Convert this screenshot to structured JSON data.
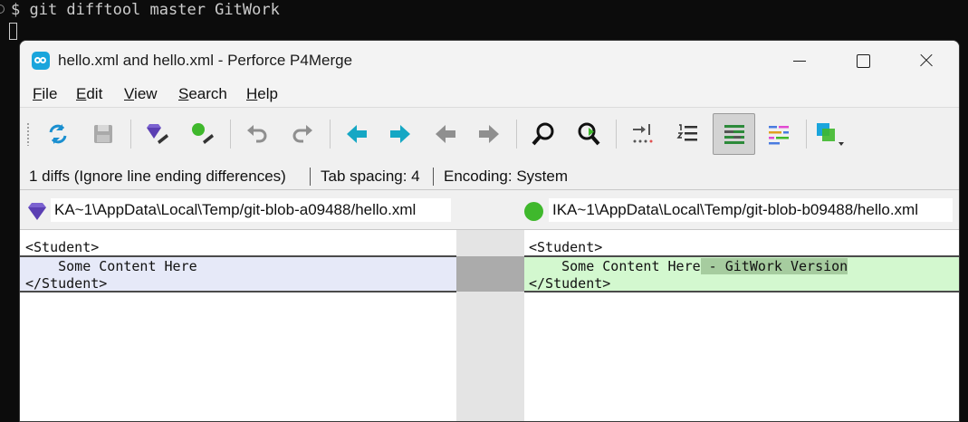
{
  "terminal": {
    "command": "$ git difftool master GitWork"
  },
  "window": {
    "title": "hello.xml and hello.xml - Perforce P4Merge"
  },
  "menu": {
    "items": [
      "File",
      "Edit",
      "View",
      "Search",
      "Help"
    ],
    "underline": [
      "F",
      "E",
      "V",
      "S",
      "H"
    ]
  },
  "toolbar": {
    "icons": [
      "refresh-icon",
      "save-icon",
      "base-gem-icon",
      "theirs-ball-icon",
      "undo-icon",
      "redo-icon",
      "prev-diff-icon",
      "next-diff-icon",
      "prev-change-icon",
      "next-change-icon",
      "find-icon",
      "find-next-icon",
      "go-to-line-icon",
      "line-numbers-icon",
      "inline-diff-icon",
      "highlight-icon",
      "layout-icon"
    ]
  },
  "status": {
    "diffs": "1 diffs (Ignore line ending differences)",
    "tab_spacing": "Tab spacing: 4",
    "encoding": "Encoding: System"
  },
  "paths": {
    "left": "KA~1\\AppData\\Local\\Temp/git-blob-a09488/hello.xml",
    "right": "IKA~1\\AppData\\Local\\Temp/git-blob-b09488/hello.xml"
  },
  "left_pane": {
    "line1": "<Student>",
    "line2": "    Some Content Here",
    "line3": "</Student>"
  },
  "right_pane": {
    "line1": "<Student>",
    "line2": "    Some Content Here",
    "line2_added": " - GitWork Version",
    "line3": "</Student>"
  },
  "colors": {
    "left_change": "#e6e9f8",
    "right_change": "#d3f8cf",
    "right_inline": "#a6cc9f",
    "gutter": "#e4e4e4",
    "accent": "#1aa5dc"
  }
}
